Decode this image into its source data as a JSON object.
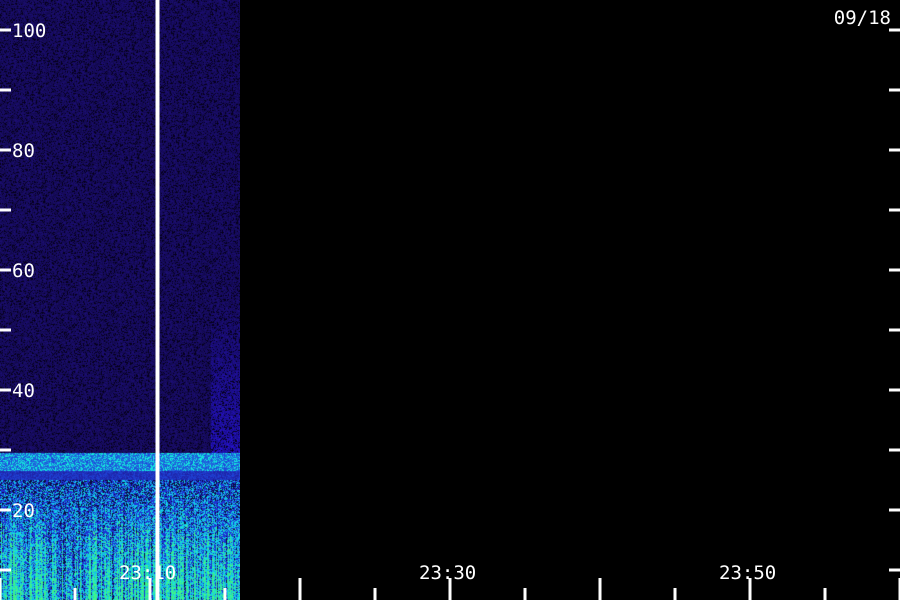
{
  "chart_data": {
    "type": "heatmap",
    "date_label": "09/18",
    "x_tick_labels": [
      "23:10",
      "23:30",
      "23:50"
    ],
    "y_tick_labels": [
      "100",
      "80",
      "60",
      "40",
      "20"
    ],
    "y_range": [
      0,
      100
    ],
    "x_range": [
      "23:00",
      "23:60"
    ],
    "data_coverage": {
      "start": "23:00",
      "end": "23:16"
    },
    "marker_line_time": "23:10.5",
    "bands": [
      {
        "y_range": [
          0,
          25
        ],
        "level": "high"
      },
      {
        "y_range": [
          27,
          29
        ],
        "level": "medium-high"
      },
      {
        "y_range": [
          30,
          100
        ],
        "level": "low"
      }
    ],
    "colors": {
      "background": "#000000",
      "low": "#3a1a9a",
      "mid": "#2233ff",
      "high": "#22dddd",
      "peak": "#44ff88",
      "axis": "#ffffff"
    }
  }
}
